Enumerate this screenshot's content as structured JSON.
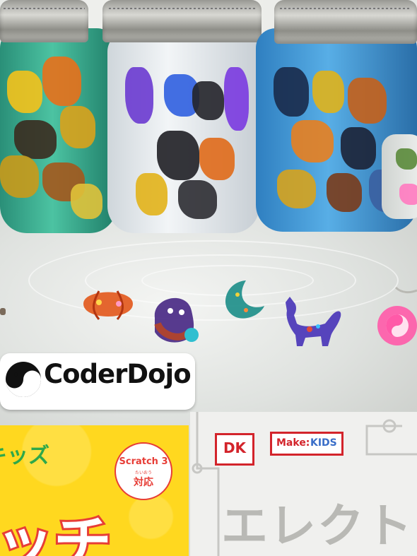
{
  "sticker": {
    "logo_text": "CoderDojo"
  },
  "book_left": {
    "series_text": "キッズ",
    "badge_line1": "Scratch 3",
    "badge_ruby": "たいおう",
    "badge_line2": "対応",
    "title_text": "ッチ"
  },
  "book_right": {
    "publisher": "DK",
    "imprint_make": "Make:",
    "imprint_kids": "KIDS",
    "title_text": "エレクトロ"
  },
  "colors": {
    "jar_green": "#2fa889",
    "jar_clear": "#dfe5ea",
    "jar_blue": "#3e8fd0",
    "pumpkin": "#e2561a",
    "ghost": "#4a2a86",
    "moon": "#1f8f8a",
    "cat": "#4a36b8",
    "charm_pink": "#ff5aa8",
    "dk_red": "#d3242b",
    "book_yellow": "#ffd81f",
    "title_red": "#e73d36"
  },
  "icons": [
    "yin-yang-icon",
    "pumpkin-charm",
    "ghost-charm",
    "moon-charm",
    "cat-charm",
    "yin-yang-keychain"
  ]
}
